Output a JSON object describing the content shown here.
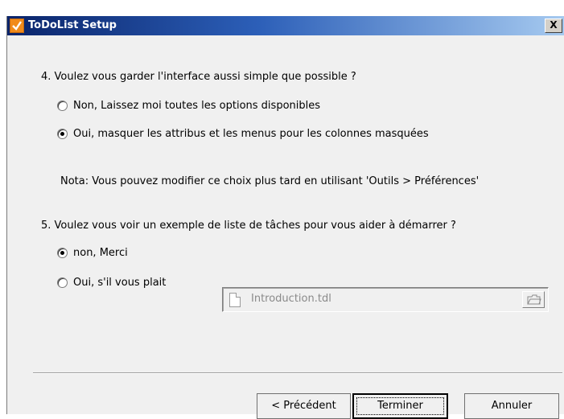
{
  "window": {
    "title": "ToDoList Setup",
    "close_label": "X"
  },
  "question4": {
    "text": "4. Voulez vous garder l'interface aussi simple que possible ?",
    "options": [
      {
        "label": "Non, Laissez moi toutes les options disponibles",
        "selected": false
      },
      {
        "label": "Oui, masquer les attribus et les menus pour les colonnes masquées",
        "selected": true
      }
    ],
    "note": "Nota: Vous pouvez modifier ce choix plus tard en utilisant 'Outils > Préférences'"
  },
  "question5": {
    "text": "5. Voulez vous voir un exemple de liste de tâches pour vous aider à démarrer ?",
    "options": [
      {
        "label": "non, Merci",
        "selected": true
      },
      {
        "label": "Oui, s'il vous plait",
        "selected": false
      }
    ],
    "file_field": {
      "value": "Introduction.tdl",
      "enabled": false
    }
  },
  "buttons": {
    "previous": "< Précédent",
    "finish": "Terminer",
    "cancel": "Annuler"
  },
  "icons": {
    "app": "checkmark-app-icon",
    "file": "document-icon",
    "browse": "folder-icon"
  },
  "colors": {
    "accent": "#f18a1a",
    "title_bar": "#0a246a"
  }
}
